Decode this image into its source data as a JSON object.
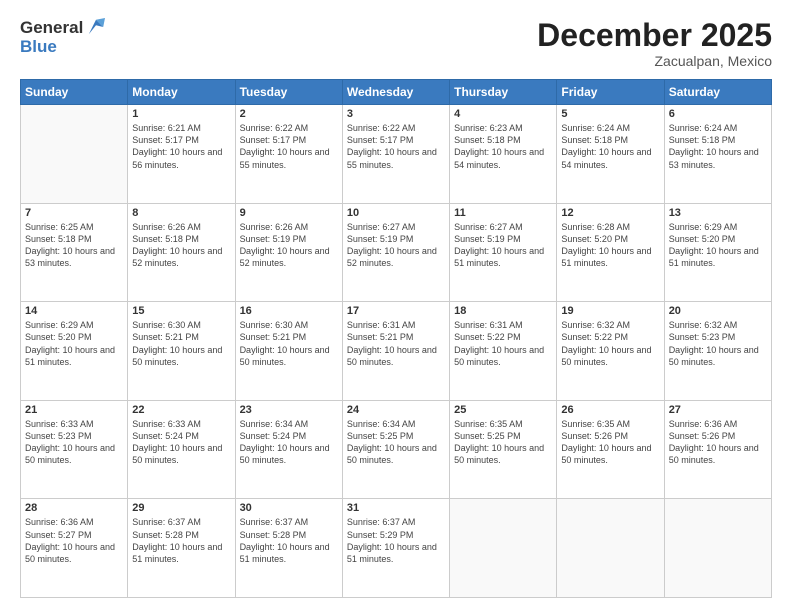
{
  "logo": {
    "general": "General",
    "blue": "Blue"
  },
  "header": {
    "month": "December 2025",
    "location": "Zacualpan, Mexico"
  },
  "weekdays": [
    "Sunday",
    "Monday",
    "Tuesday",
    "Wednesday",
    "Thursday",
    "Friday",
    "Saturday"
  ],
  "weeks": [
    [
      {
        "day": "",
        "sunrise": "",
        "sunset": "",
        "daylight": ""
      },
      {
        "day": "1",
        "sunrise": "Sunrise: 6:21 AM",
        "sunset": "Sunset: 5:17 PM",
        "daylight": "Daylight: 10 hours and 56 minutes."
      },
      {
        "day": "2",
        "sunrise": "Sunrise: 6:22 AM",
        "sunset": "Sunset: 5:17 PM",
        "daylight": "Daylight: 10 hours and 55 minutes."
      },
      {
        "day": "3",
        "sunrise": "Sunrise: 6:22 AM",
        "sunset": "Sunset: 5:17 PM",
        "daylight": "Daylight: 10 hours and 55 minutes."
      },
      {
        "day": "4",
        "sunrise": "Sunrise: 6:23 AM",
        "sunset": "Sunset: 5:18 PM",
        "daylight": "Daylight: 10 hours and 54 minutes."
      },
      {
        "day": "5",
        "sunrise": "Sunrise: 6:24 AM",
        "sunset": "Sunset: 5:18 PM",
        "daylight": "Daylight: 10 hours and 54 minutes."
      },
      {
        "day": "6",
        "sunrise": "Sunrise: 6:24 AM",
        "sunset": "Sunset: 5:18 PM",
        "daylight": "Daylight: 10 hours and 53 minutes."
      }
    ],
    [
      {
        "day": "7",
        "sunrise": "Sunrise: 6:25 AM",
        "sunset": "Sunset: 5:18 PM",
        "daylight": "Daylight: 10 hours and 53 minutes."
      },
      {
        "day": "8",
        "sunrise": "Sunrise: 6:26 AM",
        "sunset": "Sunset: 5:18 PM",
        "daylight": "Daylight: 10 hours and 52 minutes."
      },
      {
        "day": "9",
        "sunrise": "Sunrise: 6:26 AM",
        "sunset": "Sunset: 5:19 PM",
        "daylight": "Daylight: 10 hours and 52 minutes."
      },
      {
        "day": "10",
        "sunrise": "Sunrise: 6:27 AM",
        "sunset": "Sunset: 5:19 PM",
        "daylight": "Daylight: 10 hours and 52 minutes."
      },
      {
        "day": "11",
        "sunrise": "Sunrise: 6:27 AM",
        "sunset": "Sunset: 5:19 PM",
        "daylight": "Daylight: 10 hours and 51 minutes."
      },
      {
        "day": "12",
        "sunrise": "Sunrise: 6:28 AM",
        "sunset": "Sunset: 5:20 PM",
        "daylight": "Daylight: 10 hours and 51 minutes."
      },
      {
        "day": "13",
        "sunrise": "Sunrise: 6:29 AM",
        "sunset": "Sunset: 5:20 PM",
        "daylight": "Daylight: 10 hours and 51 minutes."
      }
    ],
    [
      {
        "day": "14",
        "sunrise": "Sunrise: 6:29 AM",
        "sunset": "Sunset: 5:20 PM",
        "daylight": "Daylight: 10 hours and 51 minutes."
      },
      {
        "day": "15",
        "sunrise": "Sunrise: 6:30 AM",
        "sunset": "Sunset: 5:21 PM",
        "daylight": "Daylight: 10 hours and 50 minutes."
      },
      {
        "day": "16",
        "sunrise": "Sunrise: 6:30 AM",
        "sunset": "Sunset: 5:21 PM",
        "daylight": "Daylight: 10 hours and 50 minutes."
      },
      {
        "day": "17",
        "sunrise": "Sunrise: 6:31 AM",
        "sunset": "Sunset: 5:21 PM",
        "daylight": "Daylight: 10 hours and 50 minutes."
      },
      {
        "day": "18",
        "sunrise": "Sunrise: 6:31 AM",
        "sunset": "Sunset: 5:22 PM",
        "daylight": "Daylight: 10 hours and 50 minutes."
      },
      {
        "day": "19",
        "sunrise": "Sunrise: 6:32 AM",
        "sunset": "Sunset: 5:22 PM",
        "daylight": "Daylight: 10 hours and 50 minutes."
      },
      {
        "day": "20",
        "sunrise": "Sunrise: 6:32 AM",
        "sunset": "Sunset: 5:23 PM",
        "daylight": "Daylight: 10 hours and 50 minutes."
      }
    ],
    [
      {
        "day": "21",
        "sunrise": "Sunrise: 6:33 AM",
        "sunset": "Sunset: 5:23 PM",
        "daylight": "Daylight: 10 hours and 50 minutes."
      },
      {
        "day": "22",
        "sunrise": "Sunrise: 6:33 AM",
        "sunset": "Sunset: 5:24 PM",
        "daylight": "Daylight: 10 hours and 50 minutes."
      },
      {
        "day": "23",
        "sunrise": "Sunrise: 6:34 AM",
        "sunset": "Sunset: 5:24 PM",
        "daylight": "Daylight: 10 hours and 50 minutes."
      },
      {
        "day": "24",
        "sunrise": "Sunrise: 6:34 AM",
        "sunset": "Sunset: 5:25 PM",
        "daylight": "Daylight: 10 hours and 50 minutes."
      },
      {
        "day": "25",
        "sunrise": "Sunrise: 6:35 AM",
        "sunset": "Sunset: 5:25 PM",
        "daylight": "Daylight: 10 hours and 50 minutes."
      },
      {
        "day": "26",
        "sunrise": "Sunrise: 6:35 AM",
        "sunset": "Sunset: 5:26 PM",
        "daylight": "Daylight: 10 hours and 50 minutes."
      },
      {
        "day": "27",
        "sunrise": "Sunrise: 6:36 AM",
        "sunset": "Sunset: 5:26 PM",
        "daylight": "Daylight: 10 hours and 50 minutes."
      }
    ],
    [
      {
        "day": "28",
        "sunrise": "Sunrise: 6:36 AM",
        "sunset": "Sunset: 5:27 PM",
        "daylight": "Daylight: 10 hours and 50 minutes."
      },
      {
        "day": "29",
        "sunrise": "Sunrise: 6:37 AM",
        "sunset": "Sunset: 5:28 PM",
        "daylight": "Daylight: 10 hours and 51 minutes."
      },
      {
        "day": "30",
        "sunrise": "Sunrise: 6:37 AM",
        "sunset": "Sunset: 5:28 PM",
        "daylight": "Daylight: 10 hours and 51 minutes."
      },
      {
        "day": "31",
        "sunrise": "Sunrise: 6:37 AM",
        "sunset": "Sunset: 5:29 PM",
        "daylight": "Daylight: 10 hours and 51 minutes."
      },
      {
        "day": "",
        "sunrise": "",
        "sunset": "",
        "daylight": ""
      },
      {
        "day": "",
        "sunrise": "",
        "sunset": "",
        "daylight": ""
      },
      {
        "day": "",
        "sunrise": "",
        "sunset": "",
        "daylight": ""
      }
    ]
  ]
}
